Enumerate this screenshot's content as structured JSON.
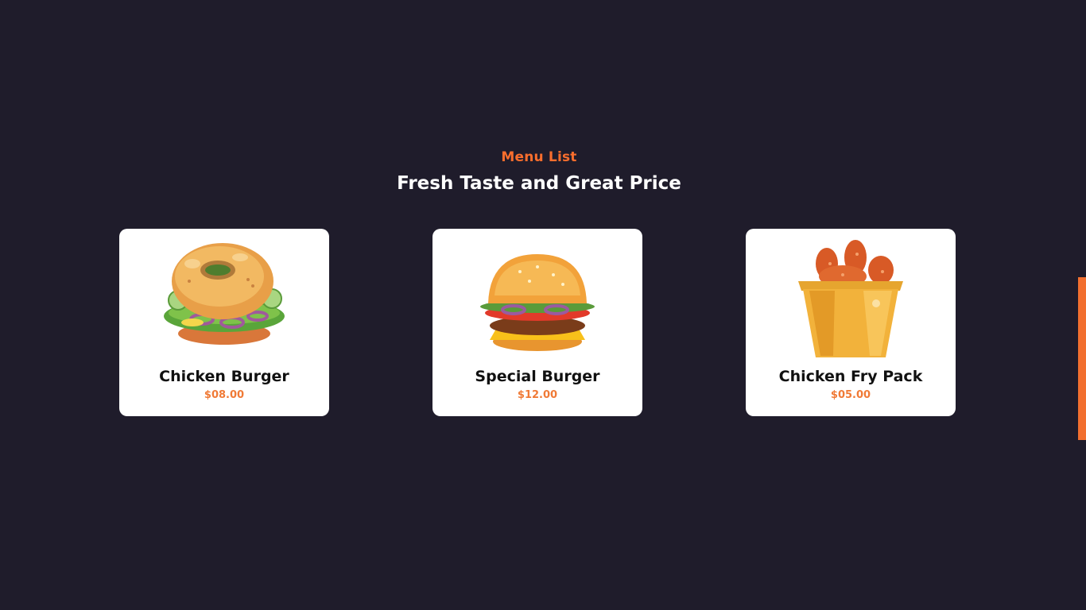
{
  "section": {
    "eyebrow": "Menu List",
    "headline": "Fresh Taste and Great Price"
  },
  "colors": {
    "background": "#1f1c2b",
    "accent": "#fa6e2d",
    "card": "#ffffff",
    "side_tab": "#f26f2f"
  },
  "menu_items": [
    {
      "name": "Chicken Burger",
      "price": "$08.00",
      "icon": "bagel-burger-icon"
    },
    {
      "name": "Special Burger",
      "price": "$12.00",
      "icon": "cheeseburger-icon"
    },
    {
      "name": "Chicken Fry Pack",
      "price": "$05.00",
      "icon": "fried-chicken-bucket-icon"
    }
  ]
}
